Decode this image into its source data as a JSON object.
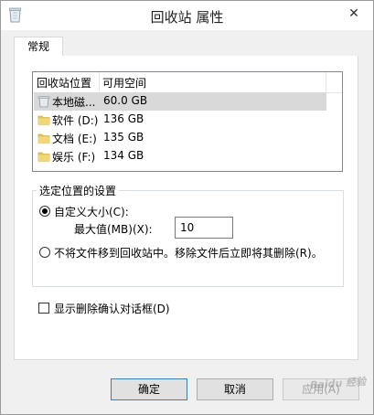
{
  "window": {
    "title": "回收站 属性",
    "close_glyph": "✕"
  },
  "tabs": [
    {
      "label": "常规",
      "selected": true
    }
  ],
  "listview": {
    "columns": [
      "回收站位置",
      "可用空间"
    ],
    "rows": [
      {
        "name": "本地磁...",
        "space": "60.0 GB",
        "selected": true,
        "icon": "recycle-bin-drive-icon"
      },
      {
        "name": "软件 (D:)",
        "space": "136 GB",
        "selected": false,
        "icon": "folder-icon"
      },
      {
        "name": "文档 (E:)",
        "space": "135 GB",
        "selected": false,
        "icon": "folder-icon"
      },
      {
        "name": "娱乐 (F:)",
        "space": "134 GB",
        "selected": false,
        "icon": "folder-icon"
      }
    ]
  },
  "settings": {
    "group_title": "选定位置的设置",
    "custom_size_label": "自定义大小(C):",
    "custom_size_selected": true,
    "max_size_label": "最大值(MB)(X):",
    "max_size_value": "10",
    "no_move_label": "不将文件移到回收站中。移除文件后立即将其删除(R)。",
    "no_move_selected": false
  },
  "confirm_dialog": {
    "label": "显示删除确认对话框(D)",
    "checked": false
  },
  "buttons": {
    "ok": "确定",
    "cancel": "取消",
    "apply": "应用(A)"
  },
  "watermark_text": "Baidu 经验",
  "colors": {
    "folder": "#e8c45a",
    "selection": "#d9d9d9",
    "default_button_border": "#3c7fb1"
  }
}
